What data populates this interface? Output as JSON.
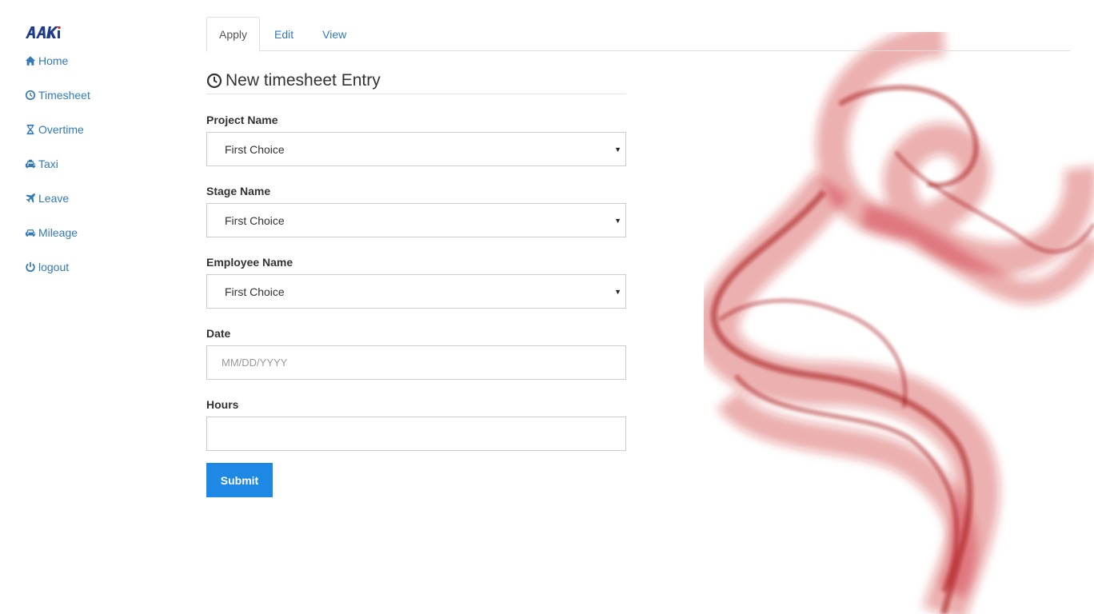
{
  "brand": {
    "logo_text": "AAKi"
  },
  "sidebar": {
    "items": [
      {
        "label": "Home",
        "icon": "home-icon"
      },
      {
        "label": "Timesheet",
        "icon": "clock-icon"
      },
      {
        "label": "Overtime",
        "icon": "hourglass-icon"
      },
      {
        "label": "Taxi",
        "icon": "taxi-icon"
      },
      {
        "label": "Leave",
        "icon": "plane-icon"
      },
      {
        "label": "Mileage",
        "icon": "car-icon"
      },
      {
        "label": "logout",
        "icon": "power-icon"
      }
    ]
  },
  "tabs": [
    {
      "label": "Apply",
      "active": true
    },
    {
      "label": "Edit",
      "active": false
    },
    {
      "label": "View",
      "active": false
    }
  ],
  "form": {
    "title": "New timesheet Entry",
    "project": {
      "label": "Project Name",
      "value": "First Choice"
    },
    "stage": {
      "label": "Stage Name",
      "value": "First Choice"
    },
    "employee": {
      "label": "Employee Name",
      "value": "First Choice"
    },
    "date": {
      "label": "Date",
      "placeholder": "MM/DD/YYYY",
      "value": ""
    },
    "hours": {
      "label": "Hours",
      "placeholder": "",
      "value": ""
    },
    "submit_label": "Submit"
  },
  "colors": {
    "link": "#337ab7",
    "button": "#1e88e5",
    "smoke": "#c0121c"
  }
}
